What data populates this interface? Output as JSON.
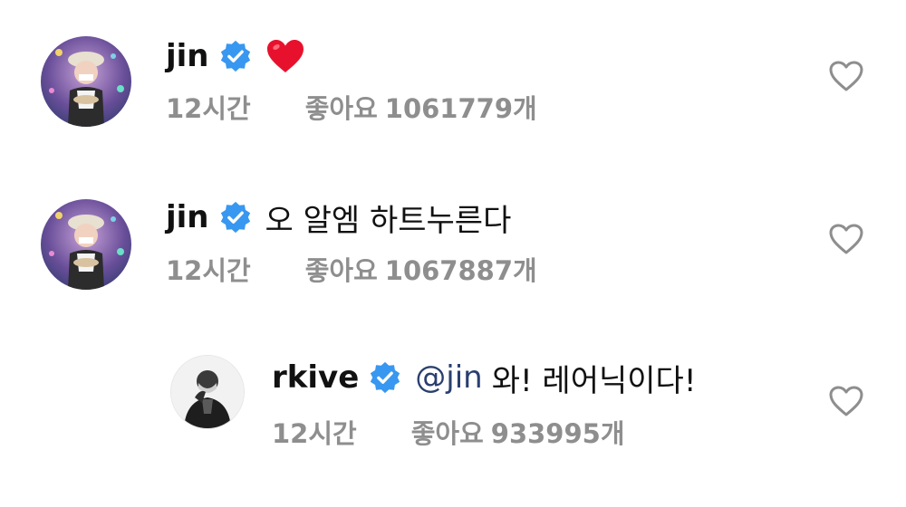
{
  "comments": [
    {
      "username": "jin",
      "text": "",
      "emoji": "red-heart-emoji",
      "time": "12시간",
      "likes_label": "좋아요",
      "likes_count": "1061779개"
    },
    {
      "username": "jin",
      "text": "오 알엠 하트누른다",
      "time": "12시간",
      "likes_label": "좋아요",
      "likes_count": "1067887개"
    },
    {
      "username": "rkive",
      "mention": "@jin",
      "text": "와! 레어닉이다!",
      "time": "12시간",
      "likes_label": "좋아요",
      "likes_count": "933995개"
    }
  ],
  "colors": {
    "verified": "#3897f0",
    "mention": "#2a3f6f",
    "meta_text": "#8e8e8e",
    "heart_emoji": "#e8112d"
  },
  "icons": {
    "verified": "verified-badge-icon",
    "like": "heart-outline-icon"
  }
}
